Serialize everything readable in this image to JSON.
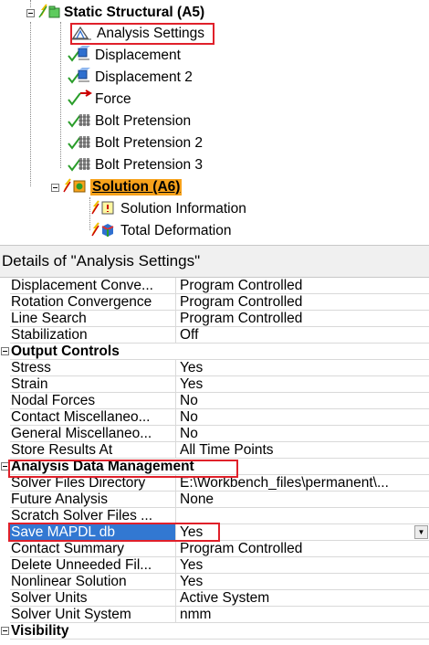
{
  "tree": {
    "root_label": "Static Structural (A5)",
    "items": [
      {
        "label": "Analysis Settings",
        "icon": "analysis-settings-icon"
      },
      {
        "label": "Displacement",
        "icon": "displacement-icon"
      },
      {
        "label": "Displacement 2",
        "icon": "displacement-icon"
      },
      {
        "label": "Force",
        "icon": "force-icon"
      },
      {
        "label": "Bolt Pretension",
        "icon": "bolt-pretension-icon"
      },
      {
        "label": "Bolt Pretension 2",
        "icon": "bolt-pretension-icon"
      },
      {
        "label": "Bolt Pretension 3",
        "icon": "bolt-pretension-icon"
      }
    ],
    "solution_label": "Solution (A6)",
    "solution_children": [
      {
        "label": "Solution Information",
        "icon": "solution-information-icon"
      },
      {
        "label": "Total Deformation",
        "icon": "total-deformation-icon"
      }
    ]
  },
  "details": {
    "title": "Details of \"Analysis Settings\"",
    "rows": [
      {
        "k": "Displacement Conve...",
        "v": "Program Controlled"
      },
      {
        "k": "Rotation Convergence",
        "v": "Program Controlled"
      },
      {
        "k": "Line Search",
        "v": "Program Controlled"
      },
      {
        "k": "Stabilization",
        "v": "Off"
      }
    ],
    "output_controls": {
      "header": "Output Controls",
      "rows": [
        {
          "k": "Stress",
          "v": "Yes"
        },
        {
          "k": "Strain",
          "v": "Yes"
        },
        {
          "k": "Nodal Forces",
          "v": "No"
        },
        {
          "k": "Contact Miscellaneo...",
          "v": "No"
        },
        {
          "k": "General Miscellaneo...",
          "v": "No"
        },
        {
          "k": "Store Results At",
          "v": "All Time Points"
        }
      ]
    },
    "analysis_data": {
      "header": "Analysis Data Management",
      "rows": [
        {
          "k": "Solver Files Directory",
          "v": "E:\\Workbench_files\\permanent\\..."
        },
        {
          "k": "Future Analysis",
          "v": "None"
        },
        {
          "k": "Scratch Solver Files ...",
          "v": ""
        },
        {
          "k": "Save MAPDL db",
          "v": "Yes"
        },
        {
          "k": "Contact Summary",
          "v": "Program Controlled"
        },
        {
          "k": "Delete Unneeded Fil...",
          "v": "Yes"
        },
        {
          "k": "Nonlinear Solution",
          "v": "Yes"
        },
        {
          "k": "Solver Units",
          "v": "Active System"
        },
        {
          "k": "Solver Unit System",
          "v": "nmm"
        }
      ]
    },
    "visibility_header": "Visibility"
  },
  "colors": {
    "highlight_box": "#e0202a",
    "solution_bg": "#f7a21b",
    "selected_row": "#3278d2"
  }
}
